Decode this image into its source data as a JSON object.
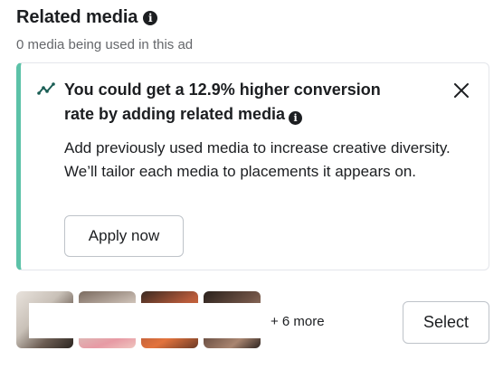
{
  "section": {
    "title": "Related media",
    "subtitle": "0 media being used in this ad"
  },
  "suggestion": {
    "headline": "You could get a 12.9% higher conversion rate by adding related media",
    "body": "Add previously used media to increase creative diversity. We’ll tailor each media to placements it appears on.",
    "apply_label": "Apply now",
    "accent_color": "#5cc2a8"
  },
  "media": {
    "more_label": "+ 6 more",
    "select_label": "Select"
  }
}
